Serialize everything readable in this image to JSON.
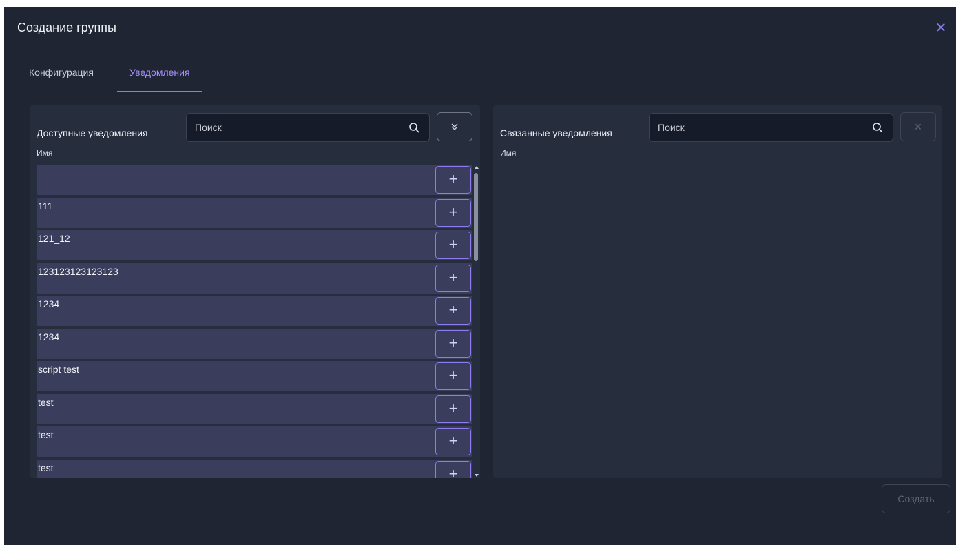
{
  "dialog": {
    "title": "Создание группы",
    "close_icon": "close-icon"
  },
  "tabs": [
    {
      "label": "Конфигурация",
      "active": false
    },
    {
      "label": "Уведомления",
      "active": true
    }
  ],
  "available": {
    "title": "Доступные уведомления",
    "search_placeholder": "Поиск",
    "column_name": "Имя",
    "expand_icon": "chevrons-down-icon",
    "items": [
      "",
      "111",
      "121_12",
      "123123123123123",
      "1234",
      "1234",
      "script test",
      "test",
      "test",
      "test"
    ],
    "add_icon": "plus-icon"
  },
  "linked": {
    "title": "Связанные уведомления",
    "search_placeholder": "Поиск",
    "column_name": "Имя",
    "clear_icon": "close-icon"
  },
  "footer": {
    "create_label": "Создать"
  },
  "colors": {
    "accent": "#8f7bf0",
    "background": "#1f2533",
    "panel": "#262d3c",
    "row": "#3a3d5c"
  }
}
